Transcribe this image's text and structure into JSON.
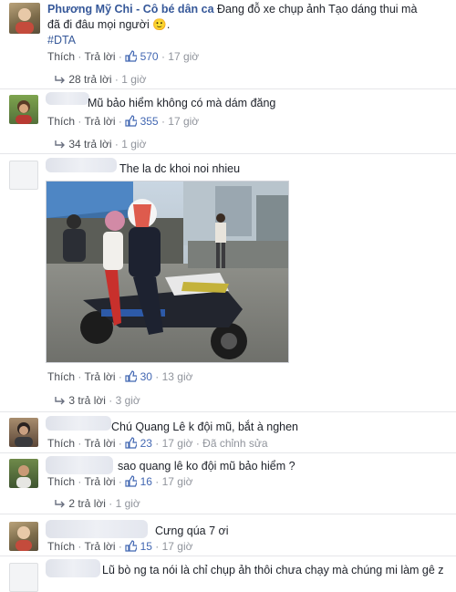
{
  "post": {
    "author": "Phương Mỹ Chi - Cô bé dân ca",
    "text_line1": "Đang đỗ xe chụp ảnh Tạo dáng thui mà",
    "text_line2": "đã đi đâu mọi người",
    "emoji": "🙂",
    "hashtag": "#DTA",
    "like_label": "Thích",
    "reply_label": "Trả lời",
    "likes": "570",
    "time": "17 giờ",
    "replies_label": "28 trả lời",
    "replies_time": "1 giờ"
  },
  "comments": [
    {
      "text": "Mũ bảo hiểm không có mà dám đăng",
      "like_label": "Thích",
      "reply_label": "Trả lời",
      "likes": "355",
      "time": "17 giờ",
      "replies_label": "34 trả lời",
      "replies_time": "1 giờ"
    },
    {
      "text": "The la dc khoi noi nhieu",
      "like_label": "Thích",
      "reply_label": "Trả lời",
      "likes": "30",
      "time": "13 giờ",
      "replies_label": "3 trả lời",
      "replies_time": "3 giờ"
    },
    {
      "text": "Chú Quang Lê k đội mũ, bắt à nghen",
      "like_label": "Thích",
      "reply_label": "Trả lời",
      "likes": "23",
      "time": "17 giờ",
      "edited": "Đã chỉnh sửa"
    },
    {
      "text": "sao quang lê ko đội mũ bảo hiểm ?",
      "like_label": "Thích",
      "reply_label": "Trả lời",
      "likes": "16",
      "time": "17 giờ",
      "replies_label": "2 trả lời",
      "replies_time": "1 giờ"
    },
    {
      "text": "Cưng qúa 7 ơi",
      "like_label": "Thích",
      "reply_label": "Trả lời",
      "likes": "15",
      "time": "17 giờ"
    },
    {
      "text": "Lũ bò ng ta nói là chỉ chụp ảh thôi chưa chạy mà chúng mi làm gê z"
    }
  ],
  "colors": {
    "link": "#365899",
    "meta": "#90949c",
    "like_blue": "#4267b2",
    "separator": "#e5e6e9"
  }
}
